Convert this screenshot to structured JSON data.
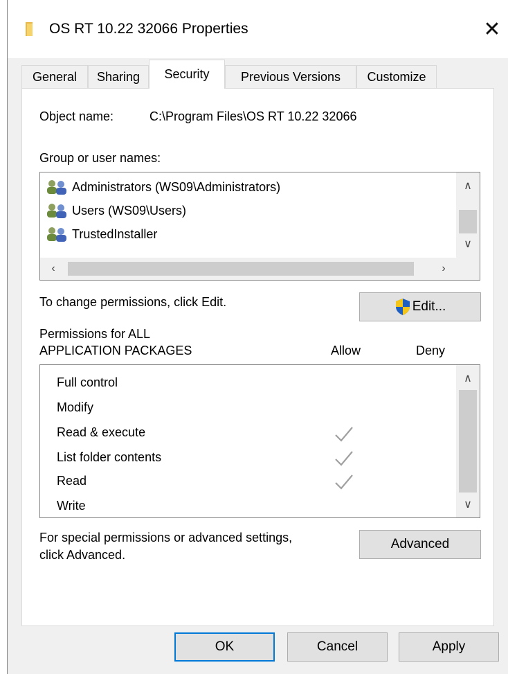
{
  "window": {
    "title": "OS RT 10.22 32066 Properties",
    "close_glyph": "✕"
  },
  "tabs": [
    {
      "label": "General",
      "active": false
    },
    {
      "label": "Sharing",
      "active": false
    },
    {
      "label": "Security",
      "active": true
    },
    {
      "label": "Previous Versions",
      "active": false
    },
    {
      "label": "Customize",
      "active": false
    }
  ],
  "security": {
    "object_name_label": "Object name:",
    "object_name_value": "C:\\Program Files\\OS RT 10.22 32066",
    "groups_label": "Group or user names:",
    "groups": [
      "Administrators (WS09\\Administrators)",
      "Users (WS09\\Users)",
      "TrustedInstaller"
    ],
    "change_text": "To change permissions, click Edit.",
    "edit_button": "Edit...",
    "permissions_label_line1": "Permissions for ALL",
    "permissions_label_line2": "APPLICATION PACKAGES",
    "allow_header": "Allow",
    "deny_header": "Deny",
    "permissions": [
      {
        "name": "Full control",
        "allow": false,
        "deny": false
      },
      {
        "name": "Modify",
        "allow": false,
        "deny": false
      },
      {
        "name": "Read & execute",
        "allow": true,
        "deny": false
      },
      {
        "name": "List folder contents",
        "allow": true,
        "deny": false
      },
      {
        "name": "Read",
        "allow": true,
        "deny": false
      },
      {
        "name": "Write",
        "allow": false,
        "deny": false
      }
    ],
    "advanced_text_line1": "For special permissions or advanced settings,",
    "advanced_text_line2": "click Advanced.",
    "advanced_button": "Advanced"
  },
  "buttons": {
    "ok": "OK",
    "cancel": "Cancel",
    "apply": "Apply"
  },
  "colors": {
    "accent": "#0078d7",
    "check": "#a0a0a0",
    "folder": "#f0c040",
    "shield_blue": "#1f5fbf",
    "shield_yellow": "#f5c518"
  }
}
